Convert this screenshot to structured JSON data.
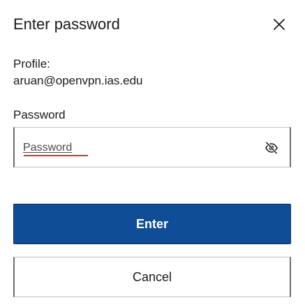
{
  "dialog": {
    "title": "Enter password",
    "close_icon": "close-icon"
  },
  "profile": {
    "label": "Profile:",
    "value": "aruan@openvpn.ias.edu"
  },
  "password": {
    "label": "Password",
    "placeholder": "Password",
    "value": "",
    "toggle_icon": "eye-slash-icon"
  },
  "actions": {
    "enter_label": "Enter",
    "cancel_label": "Cancel"
  },
  "colors": {
    "primary": "#0f4d96",
    "spellcheck": "#d1323a"
  }
}
